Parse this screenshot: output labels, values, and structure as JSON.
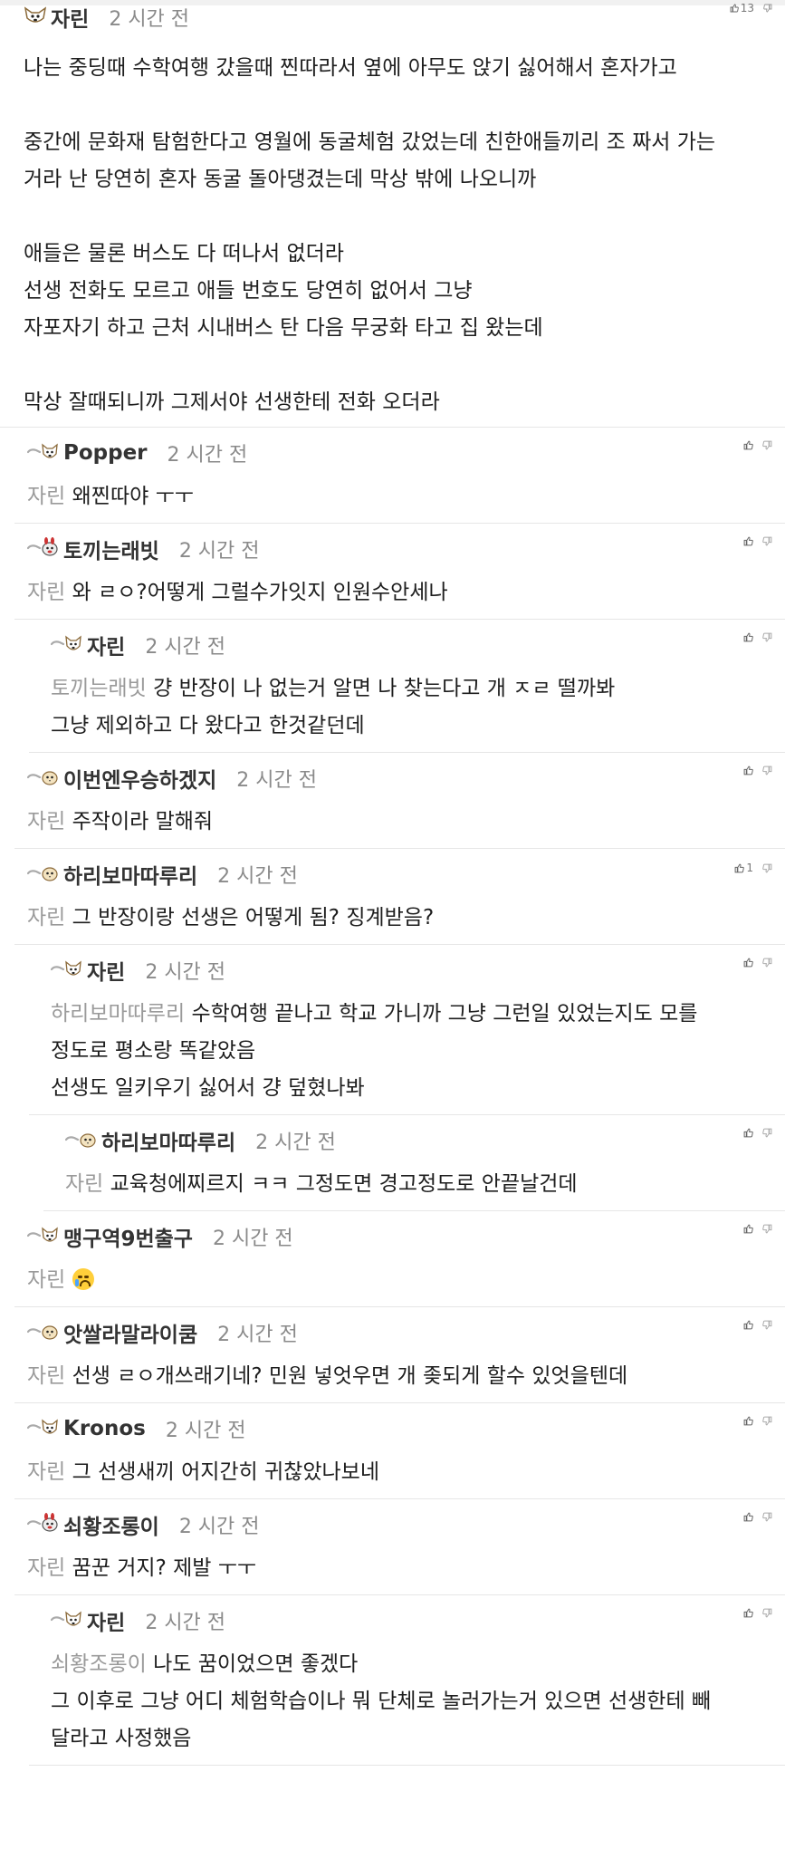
{
  "post": {
    "author": "자린",
    "time": "2 시간 전",
    "likes": "13",
    "paragraphs": [
      "나는 중딩때 수학여행 갔을때 찐따라서 옆에 아무도 앉기 싫어해서 혼자가고",
      "",
      "중간에 문화재 탐험한다고 영월에 동굴체험 갔었는데 친한애들끼리 조 짜서 가는",
      "거라 난 당연히 혼자 동굴 돌아댕겼는데 막상 밖에 나오니까",
      "",
      "애들은 물론 버스도 다 떠나서 없더라",
      "선생 전화도 모르고 애들 번호도 당연히 없어서 그냥",
      "자포자기 하고 근처 시내버스 탄 다음 무궁화 타고 집 왔는데",
      "",
      "막상 잘때되니까 그제서야 선생한테 전화 오더라"
    ]
  },
  "replies": [
    {
      "author": "Popper",
      "time": "2 시간 전",
      "mention": "자린",
      "lines": [
        "왜찐따야 ㅜㅜ"
      ],
      "likes": "",
      "avatar": "dog"
    },
    {
      "author": "토끼는래빗",
      "time": "2 시간 전",
      "mention": "자린",
      "lines": [
        "와 ㄹㅇ?어떻게 그럴수가잇지 인원수안세나"
      ],
      "likes": "",
      "avatar": "rabbit"
    },
    {
      "author": "자린",
      "time": "2 시간 전",
      "mention": "토끼는래빗",
      "lines": [
        "걍 반장이 나 없는거 알면 나 찾는다고 개 ㅈㄹ 떨까봐",
        "그냥 제외하고 다 왔다고 한것같던데"
      ],
      "likes": "",
      "avatar": "dog",
      "nested": true
    },
    {
      "author": "이번엔우승하겠지",
      "time": "2 시간 전",
      "mention": "자린",
      "lines": [
        "주작이라 말해줘"
      ],
      "likes": "",
      "avatar": "bird"
    },
    {
      "author": "하리보마따루리",
      "time": "2 시간 전",
      "mention": "자린",
      "lines": [
        "그 반장이랑 선생은 어떻게 됨? 징계받음?"
      ],
      "likes": "1",
      "avatar": "bird"
    },
    {
      "author": "자린",
      "time": "2 시간 전",
      "mention": "하리보마따루리",
      "lines": [
        "수학여행 끝나고 학교 가니까 그냥 그런일 있었는지도 모를",
        "정도로 평소랑 똑같았음",
        "선생도 일키우기 싫어서 걍 덮혔나봐"
      ],
      "likes": "",
      "avatar": "dog",
      "nested": true
    },
    {
      "author": "하리보마따루리",
      "time": "2 시간 전",
      "mention": "자린",
      "lines": [
        "교육청에찌르지 ㅋㅋ 그정도면 경고정도로 안끝날건데"
      ],
      "likes": "",
      "avatar": "bird",
      "nested2": true
    },
    {
      "author": "맹구역9번출구",
      "time": "2 시간 전",
      "mention": "자린",
      "lines": [
        "__CRY__"
      ],
      "likes": "",
      "avatar": "dog"
    },
    {
      "author": "앗쌀라말라이쿰",
      "time": "2 시간 전",
      "mention": "자린",
      "lines": [
        "선생 ㄹㅇ개쓰래기네? 민원 넣엇우면 개 좆되게 할수 있엇을텐데"
      ],
      "likes": "",
      "avatar": "bird"
    },
    {
      "author": "Kronos",
      "time": "2 시간 전",
      "mention": "자린",
      "lines": [
        "그 선생새끼 어지간히 귀찮았나보네"
      ],
      "likes": "",
      "avatar": "dog"
    },
    {
      "author": "쇠황조롱이",
      "time": "2 시간 전",
      "mention": "자린",
      "lines": [
        "꿈꾼 거지? 제발 ㅜㅜ"
      ],
      "likes": "",
      "avatar": "rabbit"
    },
    {
      "author": "자린",
      "time": "2 시간 전",
      "mention": "쇠황조롱이",
      "lines": [
        "나도 꿈이었으면 좋겠다",
        "그 이후로 그냥 어디 체험학습이나 뭐 단체로 놀러가는거 있으면 선생한테 빼",
        "달라고 사정했음"
      ],
      "likes": "",
      "avatar": "dog",
      "nested": true
    }
  ],
  "emoji": {
    "cry": "crying-face-emoji"
  },
  "colors": {
    "mention": "#9a9a9a",
    "border": "#e6e6e6",
    "time": "#8a8a8a"
  }
}
